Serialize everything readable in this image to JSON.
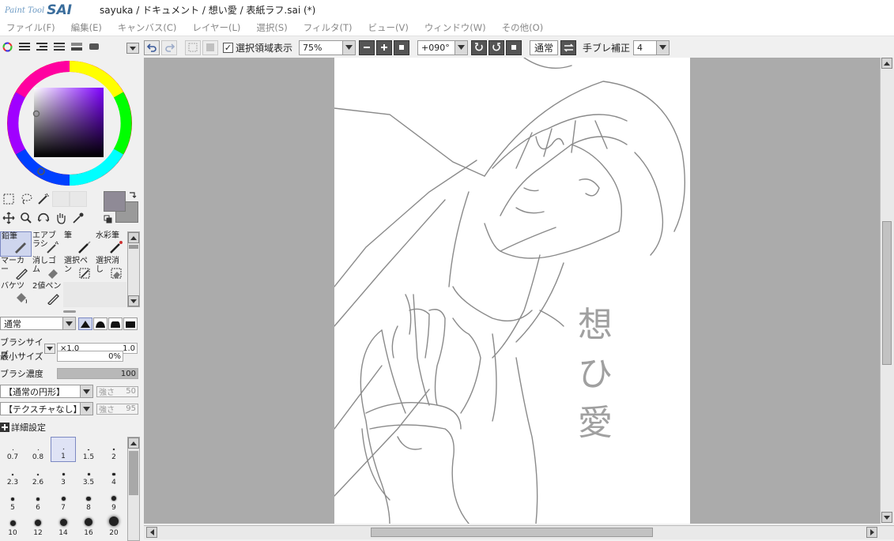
{
  "window": {
    "app_logo_prefix": "Paint Tool",
    "app_logo_main": "SAI",
    "title": "sayuka / ドキュメント / 想い愛 / 表紙ラフ.sai (*)"
  },
  "menu": {
    "items": [
      "ファイル(F)",
      "編集(E)",
      "キャンバス(C)",
      "レイヤー(L)",
      "選択(S)",
      "フィルタ(T)",
      "ビュー(V)",
      "ウィンドウ(W)",
      "その他(O)"
    ]
  },
  "toolbar": {
    "selection_display_label": "選択領域表示",
    "selection_display_checked": true,
    "zoom_value": "75%",
    "rotation_value": "+090°",
    "blend_mode": "通常",
    "stabilizer_label": "手ブレ補正",
    "stabilizer_value": "4"
  },
  "tools": {
    "brushes": [
      {
        "label": "鉛筆",
        "selected": true
      },
      {
        "label": "エアブラシ",
        "selected": false
      },
      {
        "label": "筆",
        "selected": false
      },
      {
        "label": "水彩筆",
        "selected": false
      },
      {
        "label": "マーカー",
        "selected": false
      },
      {
        "label": "消しゴム",
        "selected": false
      },
      {
        "label": "選択ペン",
        "selected": false
      },
      {
        "label": "選択消し",
        "selected": false
      },
      {
        "label": "バケツ",
        "selected": false
      },
      {
        "label": "2値ペン",
        "selected": false
      }
    ]
  },
  "brush_settings": {
    "blend_mode": "通常",
    "brush_size_label": "ブラシサイズ",
    "brush_size_multiplier": "×1.0",
    "brush_size_value": "1.0",
    "min_size_label": "最小サイズ",
    "min_size_value": "0%",
    "density_label": "ブラシ濃度",
    "density_value": "100",
    "shape_select": "【通常の円形】",
    "shape_strength_label": "強さ",
    "shape_strength_value": "50",
    "texture_select": "【テクスチャなし】",
    "texture_strength_label": "強さ",
    "texture_strength_value": "95",
    "advanced_label": "詳細設定"
  },
  "brush_sizes": [
    {
      "label": "0.7",
      "dot": 1
    },
    {
      "label": "0.8",
      "dot": 1
    },
    {
      "label": "1",
      "dot": 1,
      "selected": true
    },
    {
      "label": "1.5",
      "dot": 1.5
    },
    {
      "label": "2",
      "dot": 2
    },
    {
      "label": "2.3",
      "dot": 2
    },
    {
      "label": "2.6",
      "dot": 2.5
    },
    {
      "label": "3",
      "dot": 3
    },
    {
      "label": "3.5",
      "dot": 3
    },
    {
      "label": "4",
      "dot": 3.5
    },
    {
      "label": "5",
      "dot": 4
    },
    {
      "label": "6",
      "dot": 4.5
    },
    {
      "label": "7",
      "dot": 5
    },
    {
      "label": "8",
      "dot": 5.5
    },
    {
      "label": "9",
      "dot": 6
    },
    {
      "label": "10",
      "dot": 7
    },
    {
      "label": "12",
      "dot": 8
    },
    {
      "label": "14",
      "dot": 9
    },
    {
      "label": "16",
      "dot": 10
    },
    {
      "label": "20",
      "dot": 12
    }
  ],
  "canvas": {
    "handwritten_text": "想ひ愛"
  },
  "colors": {
    "foreground": "#8f8a96",
    "background": "#9a9a9a",
    "selection": "#cfd6ee",
    "canvas_bg": "#ababab"
  }
}
